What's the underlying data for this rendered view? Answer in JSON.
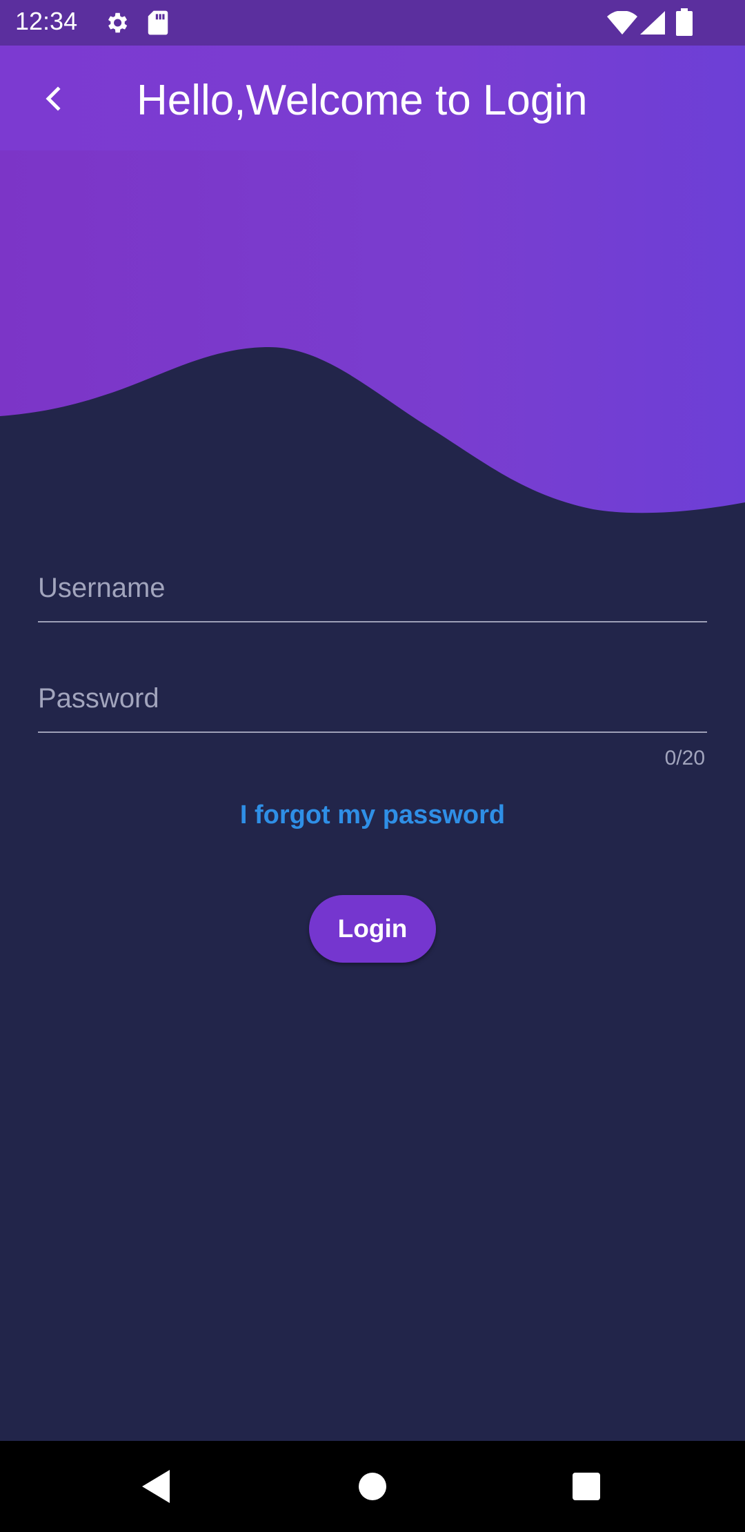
{
  "status_bar": {
    "time": "12:34",
    "icons": [
      "settings-icon",
      "sd-card-icon",
      "wifi-icon",
      "signal-icon",
      "battery-icon"
    ]
  },
  "app_bar": {
    "back_icon": "back-chevron-icon",
    "title": "Hello,Welcome to Login"
  },
  "form": {
    "username": {
      "placeholder": "Username",
      "value": ""
    },
    "password": {
      "placeholder": "Password",
      "value": "",
      "counter": "0/20"
    },
    "forgot_link": "I forgot my password",
    "login_label": "Login"
  },
  "nav_bar": {
    "icons": [
      "back-triangle-icon",
      "home-circle-icon",
      "recents-square-icon"
    ]
  },
  "colors": {
    "background": "#22254a",
    "accent": "#7536cf",
    "status_bar": "#5b2f9e",
    "link": "#2f8fe6"
  }
}
